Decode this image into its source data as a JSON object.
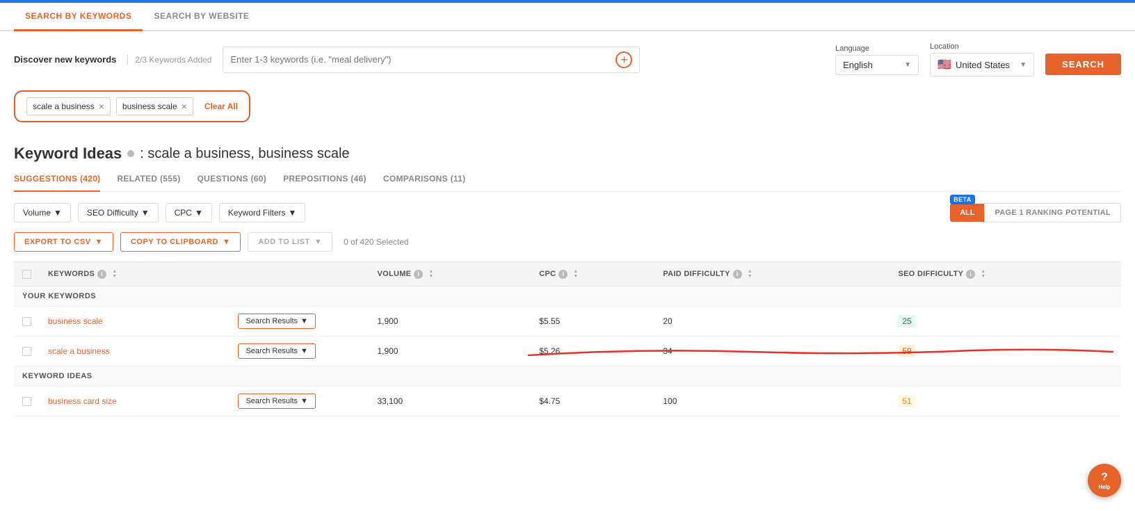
{
  "topBar": {
    "color": "#1a73e8"
  },
  "tabs": {
    "items": [
      {
        "id": "by-keywords",
        "label": "SEARCH BY KEYWORDS",
        "active": true
      },
      {
        "id": "by-website",
        "label": "SEARCH BY WEBSITE",
        "active": false
      }
    ]
  },
  "searchSection": {
    "discoverLabel": "Discover new keywords",
    "keywordsAdded": "2/3 Keywords Added",
    "inputPlaceholder": "Enter 1-3 keywords (i.e. \"meal delivery\")",
    "language": {
      "label": "Language",
      "value": "English"
    },
    "location": {
      "label": "Location",
      "value": "United States",
      "flag": "🇺🇸"
    },
    "searchButtonLabel": "SEARCH"
  },
  "tags": [
    {
      "id": "tag1",
      "label": "scale a business"
    },
    {
      "id": "tag2",
      "label": "business scale"
    }
  ],
  "clearAllLabel": "Clear All",
  "keywordIdeasTitle": "Keyword Ideas",
  "keywordIdeasSubtitle": ": scale a business, business scale",
  "subTabs": [
    {
      "id": "suggestions",
      "label": "SUGGESTIONS (420)",
      "active": true
    },
    {
      "id": "related",
      "label": "RELATED (555)",
      "active": false
    },
    {
      "id": "questions",
      "label": "QUESTIONS (60)",
      "active": false
    },
    {
      "id": "prepositions",
      "label": "PREPOSITIONS (46)",
      "active": false
    },
    {
      "id": "comparisons",
      "label": "COMPARISONS (11)",
      "active": false
    }
  ],
  "filters": [
    {
      "id": "volume",
      "label": "Volume"
    },
    {
      "id": "seo-difficulty",
      "label": "SEO Difficulty"
    },
    {
      "id": "cpc",
      "label": "CPC"
    },
    {
      "id": "keyword-filters",
      "label": "Keyword Filters"
    }
  ],
  "rankingButtons": {
    "betaLabel": "BETA",
    "allLabel": "ALL",
    "page1Label": "PAGE 1 RANKING POTENTIAL"
  },
  "actionButtons": {
    "exportLabel": "EXPORT TO CSV",
    "copyLabel": "COPY TO CLIPBOARD",
    "addToListLabel": "ADD TO LIST",
    "selectedCount": "0 of 420 Selected"
  },
  "table": {
    "headers": [
      {
        "id": "keywords",
        "label": "KEYWORDS"
      },
      {
        "id": "volume",
        "label": "VOLUME"
      },
      {
        "id": "cpc",
        "label": "CPC"
      },
      {
        "id": "paid-difficulty",
        "label": "PAID DIFFICULTY"
      },
      {
        "id": "seo-difficulty",
        "label": "SEO DIFFICULTY"
      }
    ],
    "yourKeywordsLabel": "YOUR KEYWORDS",
    "keywordIdeasLabel": "KEYWORD IDEAS",
    "rows": [
      {
        "keyword": "business scale",
        "searchResultsLabel": "Search Results",
        "volume": "1,900",
        "cpc": "$5.55",
        "paidDifficulty": "20",
        "seoDifficulty": "25",
        "seoDiffClass": "green"
      },
      {
        "keyword": "scale a business",
        "searchResultsLabel": "Search Results",
        "volume": "1,900",
        "cpc": "$5.26",
        "paidDifficulty": "34",
        "seoDifficulty": "59",
        "seoDiffClass": "orange"
      },
      {
        "keyword": "business card size",
        "searchResultsLabel": "Search Results",
        "volume": "33,100",
        "cpc": "$4.75",
        "paidDifficulty": "100",
        "seoDifficulty": "51",
        "seoDiffClass": "yellow"
      }
    ]
  },
  "helpButton": {
    "icon": "?",
    "label": "Help"
  }
}
